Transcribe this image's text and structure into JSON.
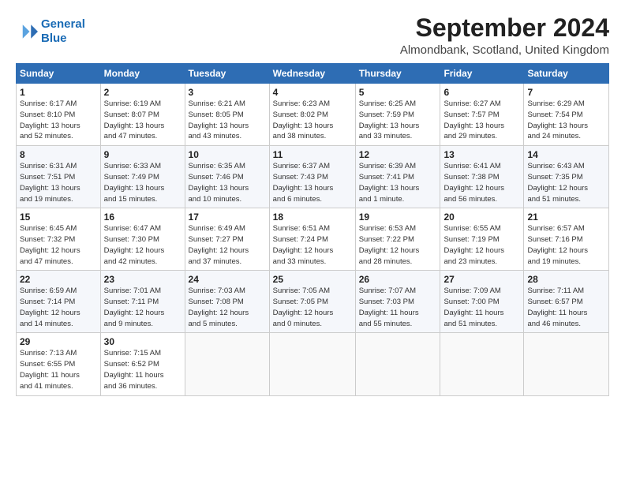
{
  "header": {
    "logo_line1": "General",
    "logo_line2": "Blue",
    "title": "September 2024",
    "subtitle": "Almondbank, Scotland, United Kingdom"
  },
  "calendar": {
    "days_of_week": [
      "Sunday",
      "Monday",
      "Tuesday",
      "Wednesday",
      "Thursday",
      "Friday",
      "Saturday"
    ],
    "weeks": [
      [
        {
          "day": "",
          "info": ""
        },
        {
          "day": "2",
          "info": "Sunrise: 6:19 AM\nSunset: 8:07 PM\nDaylight: 13 hours\nand 47 minutes."
        },
        {
          "day": "3",
          "info": "Sunrise: 6:21 AM\nSunset: 8:05 PM\nDaylight: 13 hours\nand 43 minutes."
        },
        {
          "day": "4",
          "info": "Sunrise: 6:23 AM\nSunset: 8:02 PM\nDaylight: 13 hours\nand 38 minutes."
        },
        {
          "day": "5",
          "info": "Sunrise: 6:25 AM\nSunset: 7:59 PM\nDaylight: 13 hours\nand 33 minutes."
        },
        {
          "day": "6",
          "info": "Sunrise: 6:27 AM\nSunset: 7:57 PM\nDaylight: 13 hours\nand 29 minutes."
        },
        {
          "day": "7",
          "info": "Sunrise: 6:29 AM\nSunset: 7:54 PM\nDaylight: 13 hours\nand 24 minutes."
        }
      ],
      [
        {
          "day": "1",
          "info": "Sunrise: 6:17 AM\nSunset: 8:10 PM\nDaylight: 13 hours\nand 52 minutes."
        },
        {
          "day": "9",
          "info": "Sunrise: 6:33 AM\nSunset: 7:49 PM\nDaylight: 13 hours\nand 15 minutes."
        },
        {
          "day": "10",
          "info": "Sunrise: 6:35 AM\nSunset: 7:46 PM\nDaylight: 13 hours\nand 10 minutes."
        },
        {
          "day": "11",
          "info": "Sunrise: 6:37 AM\nSunset: 7:43 PM\nDaylight: 13 hours\nand 6 minutes."
        },
        {
          "day": "12",
          "info": "Sunrise: 6:39 AM\nSunset: 7:41 PM\nDaylight: 13 hours\nand 1 minute."
        },
        {
          "day": "13",
          "info": "Sunrise: 6:41 AM\nSunset: 7:38 PM\nDaylight: 12 hours\nand 56 minutes."
        },
        {
          "day": "14",
          "info": "Sunrise: 6:43 AM\nSunset: 7:35 PM\nDaylight: 12 hours\nand 51 minutes."
        }
      ],
      [
        {
          "day": "8",
          "info": "Sunrise: 6:31 AM\nSunset: 7:51 PM\nDaylight: 13 hours\nand 19 minutes."
        },
        {
          "day": "16",
          "info": "Sunrise: 6:47 AM\nSunset: 7:30 PM\nDaylight: 12 hours\nand 42 minutes."
        },
        {
          "day": "17",
          "info": "Sunrise: 6:49 AM\nSunset: 7:27 PM\nDaylight: 12 hours\nand 37 minutes."
        },
        {
          "day": "18",
          "info": "Sunrise: 6:51 AM\nSunset: 7:24 PM\nDaylight: 12 hours\nand 33 minutes."
        },
        {
          "day": "19",
          "info": "Sunrise: 6:53 AM\nSunset: 7:22 PM\nDaylight: 12 hours\nand 28 minutes."
        },
        {
          "day": "20",
          "info": "Sunrise: 6:55 AM\nSunset: 7:19 PM\nDaylight: 12 hours\nand 23 minutes."
        },
        {
          "day": "21",
          "info": "Sunrise: 6:57 AM\nSunset: 7:16 PM\nDaylight: 12 hours\nand 19 minutes."
        }
      ],
      [
        {
          "day": "15",
          "info": "Sunrise: 6:45 AM\nSunset: 7:32 PM\nDaylight: 12 hours\nand 47 minutes."
        },
        {
          "day": "23",
          "info": "Sunrise: 7:01 AM\nSunset: 7:11 PM\nDaylight: 12 hours\nand 9 minutes."
        },
        {
          "day": "24",
          "info": "Sunrise: 7:03 AM\nSunset: 7:08 PM\nDaylight: 12 hours\nand 5 minutes."
        },
        {
          "day": "25",
          "info": "Sunrise: 7:05 AM\nSunset: 7:05 PM\nDaylight: 12 hours\nand 0 minutes."
        },
        {
          "day": "26",
          "info": "Sunrise: 7:07 AM\nSunset: 7:03 PM\nDaylight: 11 hours\nand 55 minutes."
        },
        {
          "day": "27",
          "info": "Sunrise: 7:09 AM\nSunset: 7:00 PM\nDaylight: 11 hours\nand 51 minutes."
        },
        {
          "day": "28",
          "info": "Sunrise: 7:11 AM\nSunset: 6:57 PM\nDaylight: 11 hours\nand 46 minutes."
        }
      ],
      [
        {
          "day": "22",
          "info": "Sunrise: 6:59 AM\nSunset: 7:14 PM\nDaylight: 12 hours\nand 14 minutes."
        },
        {
          "day": "30",
          "info": "Sunrise: 7:15 AM\nSunset: 6:52 PM\nDaylight: 11 hours\nand 36 minutes."
        },
        {
          "day": "",
          "info": ""
        },
        {
          "day": "",
          "info": ""
        },
        {
          "day": "",
          "info": ""
        },
        {
          "day": "",
          "info": ""
        },
        {
          "day": "",
          "info": ""
        }
      ],
      [
        {
          "day": "29",
          "info": "Sunrise: 7:13 AM\nSunset: 6:55 PM\nDaylight: 11 hours\nand 41 minutes."
        },
        {
          "day": "",
          "info": ""
        },
        {
          "day": "",
          "info": ""
        },
        {
          "day": "",
          "info": ""
        },
        {
          "day": "",
          "info": ""
        },
        {
          "day": "",
          "info": ""
        },
        {
          "day": "",
          "info": ""
        }
      ]
    ]
  }
}
